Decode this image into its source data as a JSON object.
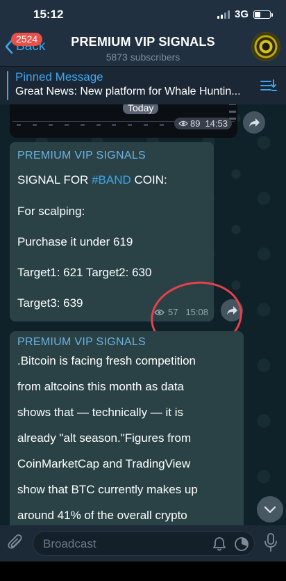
{
  "status_bar": {
    "time": "15:12",
    "network": "3G"
  },
  "header": {
    "back_label": "Back",
    "unread_badge": "2524",
    "title": "PREMIUM VIP SIGNALS",
    "subtitle": "5873 subscribers"
  },
  "pinned": {
    "title": "Pinned Message",
    "text": "Great News: New platform for Whale Huntin..."
  },
  "photo_message": {
    "date_label": "Today",
    "views": "89",
    "time": "14:53"
  },
  "message1": {
    "sender": "PREMIUM VIP SIGNALS",
    "line1_prefix": "SIGNAL FOR ",
    "line1_hashtag": "#BAND",
    "line1_suffix": " COIN:",
    "line2": "For scalping:",
    "line3": "Purchase it under 619",
    "line4": "Target1: 621 Target2: 630",
    "line5": "Target3: 639",
    "views": "57",
    "time": "15:08"
  },
  "message2": {
    "sender": "PREMIUM VIP SIGNALS",
    "lines": [
      ".Bitcoin is facing fresh competition",
      "from altcoins this month as data",
      "shows that — technically — it is",
      "already \"alt season.\"Figures from",
      "CoinMarketCap and TradingView",
      "show that BTC currently makes up",
      "around 41% of the overall crypto"
    ]
  },
  "input": {
    "placeholder": "Broadcast"
  },
  "colors": {
    "accent": "#3ea6ec",
    "bubble": "#2a4246",
    "annotation": "#e8414c",
    "badge": "#e5504a"
  },
  "icons": [
    "back-chevron-icon",
    "pinned-list-icon",
    "eye-icon",
    "share-icon",
    "chevron-down-icon",
    "attach-icon",
    "bell-icon",
    "timer-icon",
    "mic-icon"
  ]
}
